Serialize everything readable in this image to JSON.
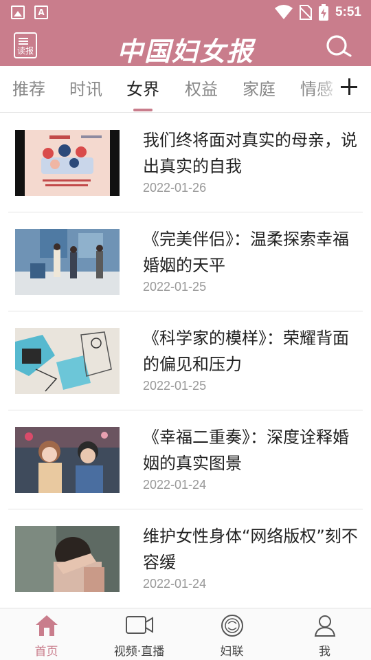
{
  "status_bar": {
    "time": "5:51",
    "notification_icons": [
      "image-icon",
      "font-icon"
    ],
    "system_icons": [
      "wifi-icon",
      "no-sim-icon",
      "battery-charging-icon"
    ]
  },
  "header": {
    "read_label": "读报",
    "title": "中国妇女报",
    "icons": {
      "read": "newspaper-icon",
      "search": "search-icon"
    },
    "bg_color": "#c97d8c"
  },
  "tabs": {
    "items": [
      {
        "label": "推荐"
      },
      {
        "label": "时讯"
      },
      {
        "label": "女界"
      },
      {
        "label": "权益"
      },
      {
        "label": "家庭"
      },
      {
        "label": "情感"
      }
    ],
    "active_index": 2,
    "add_icon": "plus-icon"
  },
  "news": [
    {
      "title": "我们终将面对真实的母亲，说出真实的自我",
      "date": "2022-01-26"
    },
    {
      "title": "《完美伴侣》：温柔探索幸福婚姻的天平",
      "date": "2022-01-25"
    },
    {
      "title": "《科学家的模样》：荣耀背面的偏见和压力",
      "date": "2022-01-25"
    },
    {
      "title": "《幸福二重奏》：深度诠释婚姻的真实图景",
      "date": "2022-01-24"
    },
    {
      "title": "维护女性身体“网络版权”刻不容缓",
      "date": "2022-01-24"
    }
  ],
  "bottom_nav": {
    "items": [
      {
        "label": "首页",
        "icon": "home-icon"
      },
      {
        "label": "视频·直播",
        "icon": "video-icon"
      },
      {
        "label": "妇联",
        "icon": "womens-federation-icon"
      },
      {
        "label": "我",
        "icon": "user-icon"
      }
    ],
    "active_index": 0
  },
  "colors": {
    "accent": "#c97d8c",
    "text": "#222222",
    "muted": "#999999"
  }
}
